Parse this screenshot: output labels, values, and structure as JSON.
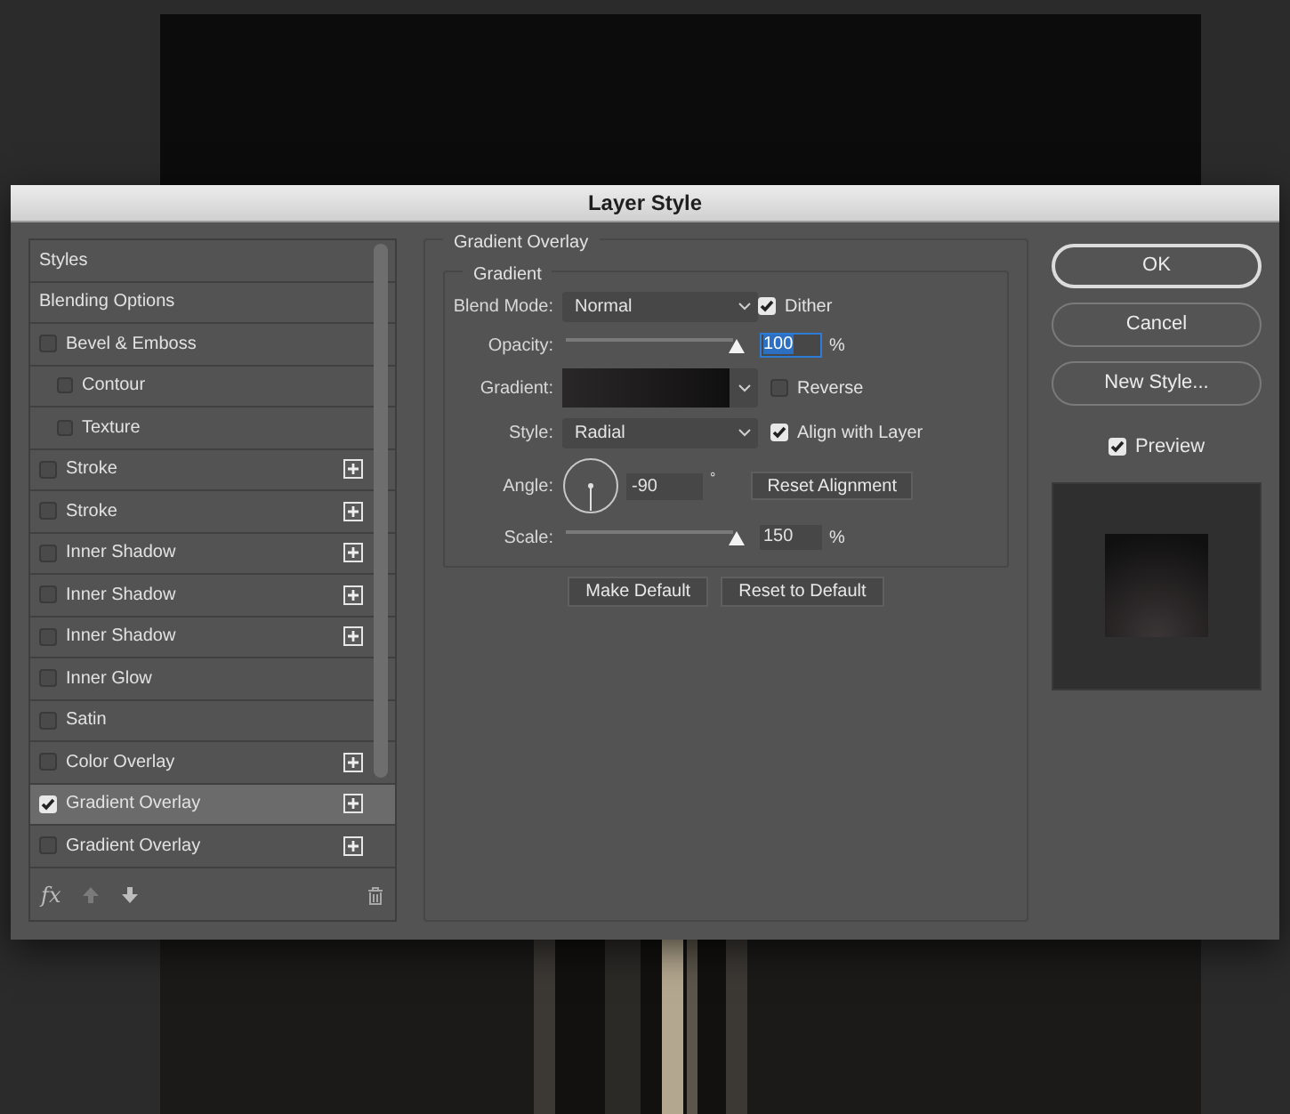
{
  "window": {
    "title": "Layer Style"
  },
  "styles_list": {
    "items": [
      {
        "label": "Styles",
        "kind": "header",
        "selected": false
      },
      {
        "label": "Blending Options",
        "kind": "header",
        "selected": false
      },
      {
        "label": "Bevel & Emboss",
        "kind": "effect",
        "checked": false,
        "selected": false,
        "add_button": false
      },
      {
        "label": "Contour",
        "kind": "sub",
        "checked": false,
        "selected": false
      },
      {
        "label": "Texture",
        "kind": "sub",
        "checked": false,
        "selected": false
      },
      {
        "label": "Stroke",
        "kind": "effect",
        "checked": false,
        "selected": false,
        "add_button": true
      },
      {
        "label": "Stroke",
        "kind": "effect",
        "checked": false,
        "selected": false,
        "add_button": true
      },
      {
        "label": "Inner Shadow",
        "kind": "effect",
        "checked": false,
        "selected": false,
        "add_button": true
      },
      {
        "label": "Inner Shadow",
        "kind": "effect",
        "checked": false,
        "selected": false,
        "add_button": true
      },
      {
        "label": "Inner Shadow",
        "kind": "effect",
        "checked": false,
        "selected": false,
        "add_button": true
      },
      {
        "label": "Inner Glow",
        "kind": "effect",
        "checked": false,
        "selected": false,
        "add_button": false
      },
      {
        "label": "Satin",
        "kind": "effect",
        "checked": false,
        "selected": false,
        "add_button": false
      },
      {
        "label": "Color Overlay",
        "kind": "effect",
        "checked": false,
        "selected": false,
        "add_button": true
      },
      {
        "label": "Gradient Overlay",
        "kind": "effect",
        "checked": true,
        "selected": true,
        "add_button": true
      },
      {
        "label": "Gradient Overlay",
        "kind": "effect",
        "checked": false,
        "selected": false,
        "add_button": true
      }
    ],
    "footer": {
      "fx_label": "fx"
    }
  },
  "gradient_overlay": {
    "section_title": "Gradient Overlay",
    "group_title": "Gradient",
    "blend_mode": {
      "label": "Blend Mode:",
      "value": "Normal"
    },
    "dither": {
      "label": "Dither",
      "checked": true
    },
    "opacity": {
      "label": "Opacity:",
      "level": 1,
      "value": "100",
      "unit": "%"
    },
    "gradient": {
      "label": "Gradient:"
    },
    "reverse": {
      "label": "Reverse",
      "checked": false
    },
    "style": {
      "label": "Style:",
      "value": "Radial"
    },
    "align_with_layer": {
      "label": "Align with Layer",
      "checked": true
    },
    "angle": {
      "label": "Angle:",
      "value": "-90",
      "unit": "°"
    },
    "reset_alignment": "Reset Alignment",
    "scale": {
      "label": "Scale:",
      "level": 1,
      "value": "150",
      "unit": "%"
    },
    "buttons": [
      "Make Default",
      "Reset to Default"
    ]
  },
  "actions": [
    {
      "label": "OK",
      "kind": "default"
    },
    {
      "label": "Cancel",
      "kind": "normal"
    },
    {
      "label": "New Style...",
      "kind": "normal"
    }
  ],
  "preview": {
    "label": "Preview",
    "checked": true
  }
}
